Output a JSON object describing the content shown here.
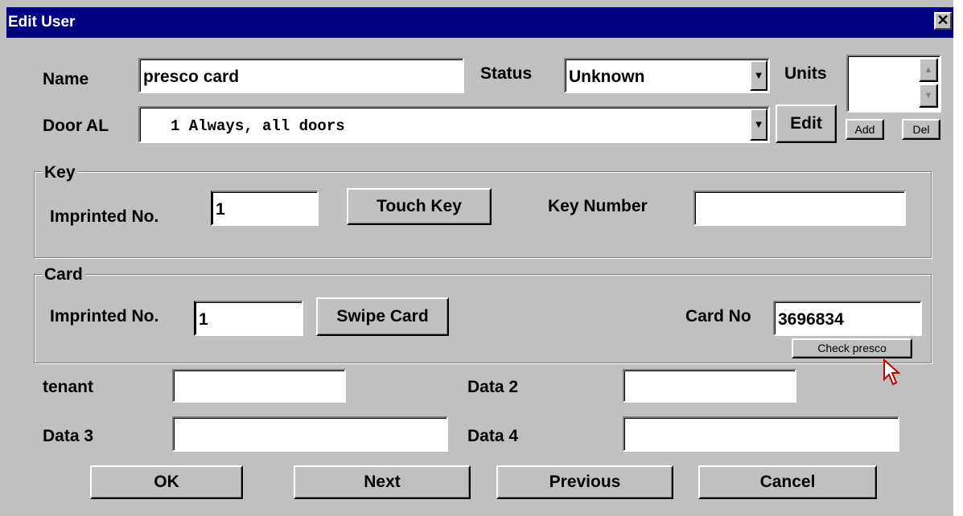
{
  "window": {
    "title": "Edit User",
    "close_glyph": "✕"
  },
  "fields": {
    "name": {
      "label": "Name",
      "value": "presco card"
    },
    "status": {
      "label": "Status",
      "value": "Unknown"
    },
    "units": {
      "label": "Units",
      "add_label": "Add",
      "del_label": "Del"
    },
    "door_al": {
      "label": "Door AL",
      "value": "1 Always, all doors",
      "edit_label": "Edit"
    }
  },
  "key_group": {
    "title": "Key",
    "imprinted_label": "Imprinted No.",
    "imprinted_value": "1",
    "touch_key_label": "Touch Key",
    "key_number_label": "Key Number",
    "key_number_value": ""
  },
  "card_group": {
    "title": "Card",
    "imprinted_label": "Imprinted No.",
    "imprinted_value": "1",
    "swipe_card_label": "Swipe Card",
    "card_no_label": "Card No",
    "card_no_value": "3696834",
    "check_label": "Check presco"
  },
  "data_fields": {
    "tenant_label": "tenant",
    "tenant_value": "",
    "data2_label": "Data 2",
    "data2_value": "",
    "data3_label": "Data 3",
    "data3_value": "",
    "data4_label": "Data 4",
    "data4_value": ""
  },
  "buttons": {
    "ok": "OK",
    "next": "Next",
    "previous": "Previous",
    "cancel": "Cancel"
  },
  "icons": {
    "combo_arrow": "▼",
    "spin_up": "▲",
    "spin_down": "▼"
  }
}
